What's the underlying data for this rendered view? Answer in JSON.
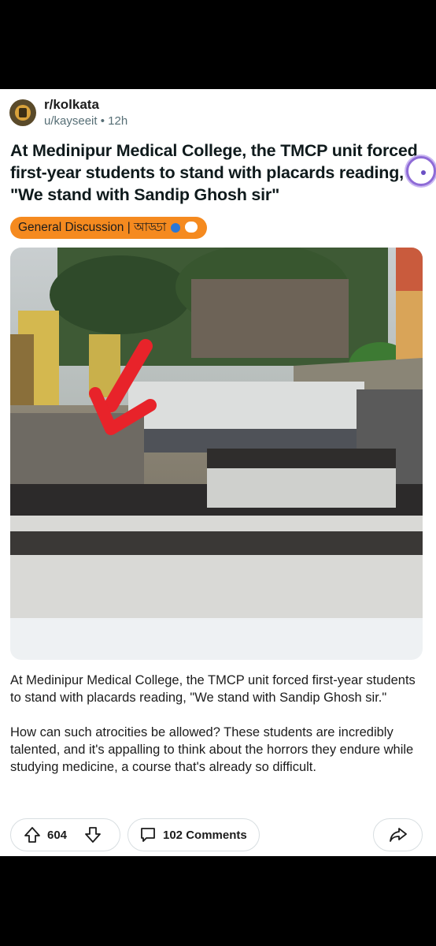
{
  "post": {
    "subreddit": "r/kolkata",
    "author": "u/kayseeit",
    "separator": "•",
    "age": "12h",
    "title": "At Medinipur Medical College, the TMCP unit forced first-year students to stand with placards reading, \"We stand with Sandip Ghosh sir\"",
    "flair": "General Discussion | আড্ডা",
    "body": [
      "At Medinipur Medical College, the TMCP unit forced first-year students to stand with placards reading, \"We stand with Sandip Ghosh sir.\"",
      "How can such atrocities be allowed? These students are incredibly talented, and it's appalling to think about the horrors they endure while studying medicine, a course that's already so difficult."
    ]
  },
  "actions": {
    "upvotes": "604",
    "comments_label": "102 Comments"
  },
  "icons": {
    "avatar": "subreddit-avatar",
    "upvote": "arrow-up-icon",
    "downvote": "arrow-down-icon",
    "comment": "comment-bubble-icon",
    "share": "share-arrow-icon"
  },
  "colors": {
    "flair_bg": "#f58a1f",
    "arrow_annotation": "#e8232a",
    "overlay_ring": "#8e6bd6"
  }
}
